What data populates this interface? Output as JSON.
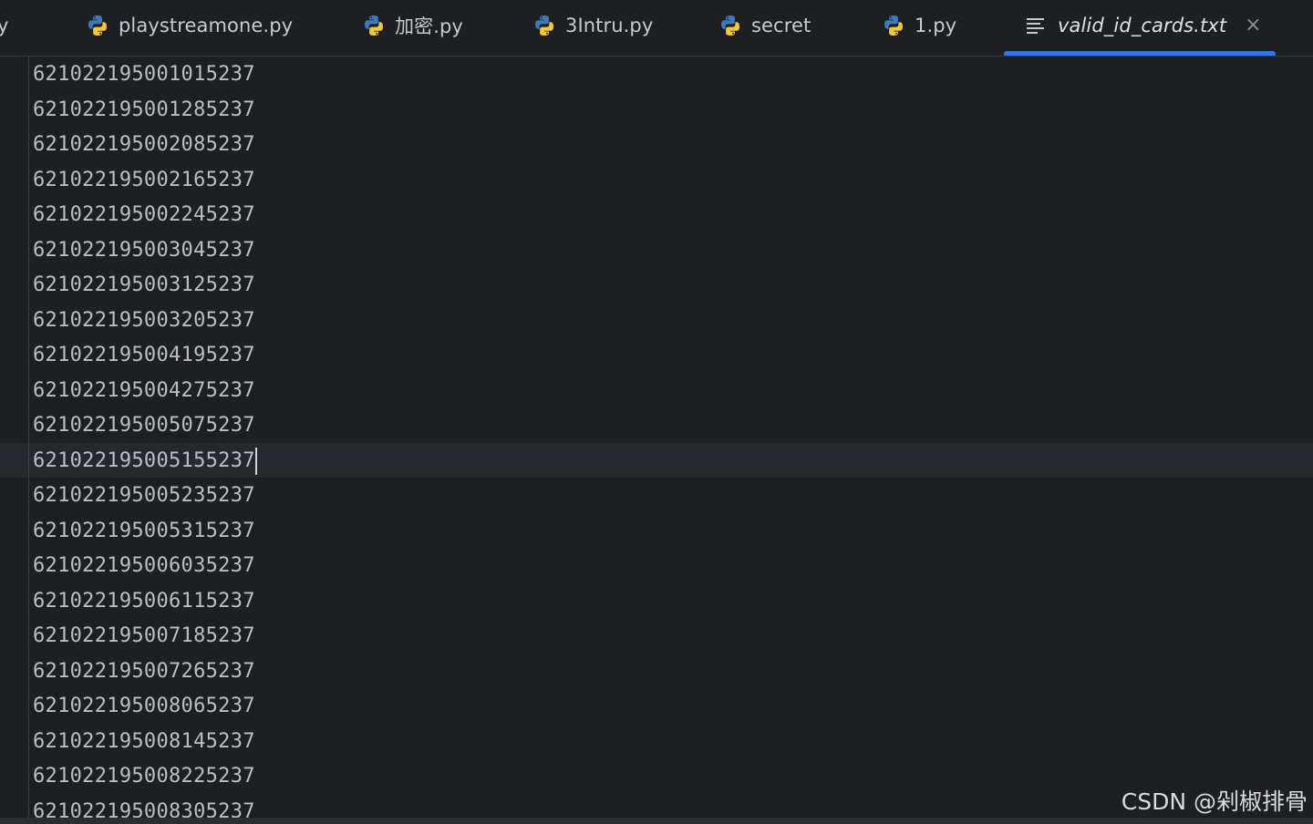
{
  "tabs": [
    {
      "label": "y",
      "icon": "python-file-icon",
      "active": false
    },
    {
      "label": "playstreamone.py",
      "icon": "python-file-icon",
      "active": false
    },
    {
      "label": "加密.py",
      "icon": "python-file-icon",
      "active": false
    },
    {
      "label": "3Intru.py",
      "icon": "python-file-icon",
      "active": false
    },
    {
      "label": "secret",
      "icon": "python-file-icon",
      "active": false
    },
    {
      "label": "1.py",
      "icon": "python-file-icon",
      "active": false
    },
    {
      "label": "valid_id_cards.txt",
      "icon": "text-file-icon",
      "active": true,
      "close": "×"
    }
  ],
  "editor": {
    "lines": [
      "621022195001015237",
      "621022195001285237",
      "621022195002085237",
      "621022195002165237",
      "621022195002245237",
      "621022195003045237",
      "621022195003125237",
      "621022195003205237",
      "621022195004195237",
      "621022195004275237",
      "621022195005075237",
      "621022195005155237",
      "621022195005235237",
      "621022195005315237",
      "621022195006035237",
      "621022195006115237",
      "621022195007185237",
      "621022195007265237",
      "621022195008065237",
      "621022195008145237",
      "621022195008225237",
      "621022195008305237"
    ],
    "caret_line": 12
  },
  "watermark": "CSDN @剁椒排骨",
  "colors": {
    "background": "#1e1f22",
    "accent": "#3574f0",
    "text": "#bcbec4"
  }
}
